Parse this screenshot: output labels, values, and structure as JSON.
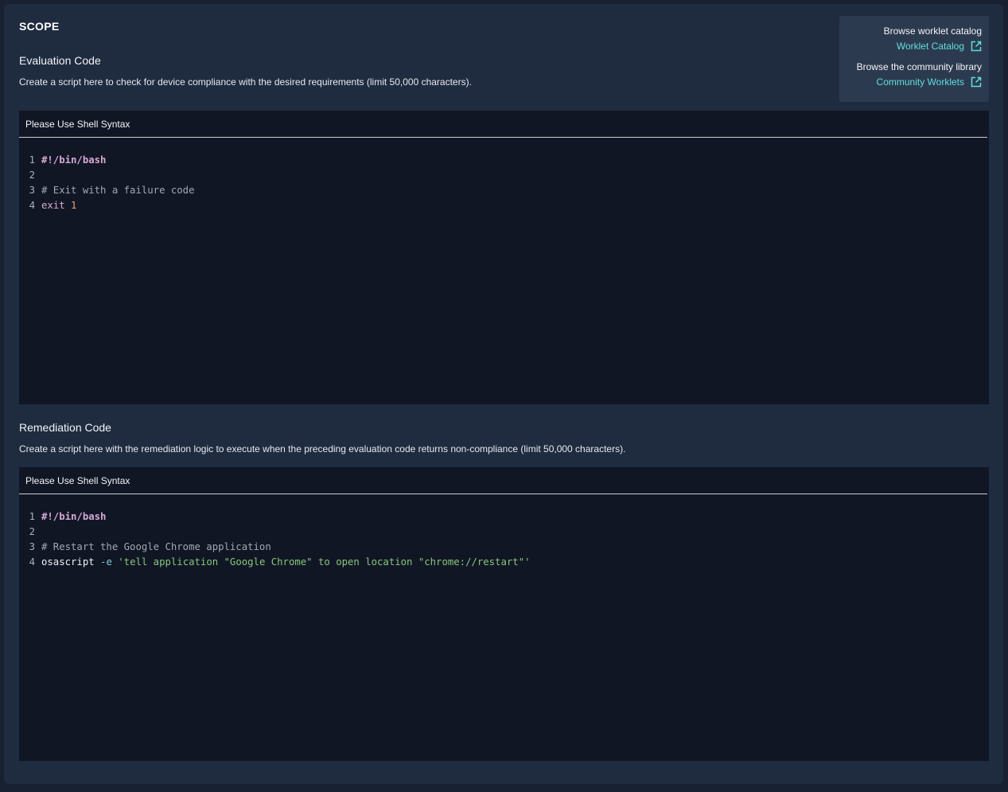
{
  "scope": {
    "title": "SCOPE"
  },
  "evaluation": {
    "title": "Evaluation Code",
    "description": "Create a script here to check for device compliance with the desired requirements (limit 50,000 characters).",
    "editor_header": "Please Use Shell Syntax",
    "line_numbers": [
      "1",
      "2",
      "3",
      "4"
    ],
    "code": {
      "line1": "#!/bin/bash",
      "line3": "# Exit with a failure code",
      "line4_cmd": "exit",
      "line4_arg": "1"
    }
  },
  "remediation": {
    "title": "Remediation Code",
    "description": "Create a script here with the remediation logic to execute when the preceding evaluation code returns non-compliance (limit 50,000 characters).",
    "editor_header": "Please Use Shell Syntax",
    "line_numbers": [
      "1",
      "2",
      "3",
      "4"
    ],
    "code": {
      "line1": "#!/bin/bash",
      "line3": "# Restart the Google Chrome application",
      "line4_cmd": "osascript",
      "line4_flag": "-e",
      "line4_str": "'tell application \"Google Chrome\" to open location \"chrome://restart\"'"
    }
  },
  "links": {
    "catalog_label": "Browse worklet catalog",
    "catalog_link": "Worklet Catalog",
    "community_label": "Browse the community library",
    "community_link": "Community Worklets",
    "icon": "external-link-icon"
  },
  "colors": {
    "background": "#182131",
    "card": "#1f2c40",
    "editor": "#111624",
    "link": "#5fe0dc"
  }
}
